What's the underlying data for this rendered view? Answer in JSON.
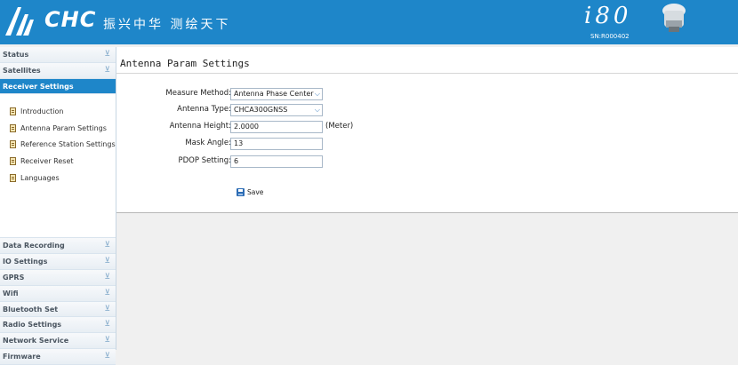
{
  "header": {
    "brand": "CHC",
    "brand_cn": "振兴中华 测绘天下",
    "model": "i80",
    "serial": "SN:R000402"
  },
  "sidebar": {
    "top_items": [
      {
        "label": "Status"
      },
      {
        "label": "Satellites"
      },
      {
        "label": "Receiver Settings"
      }
    ],
    "sub_items": [
      {
        "label": "Introduction"
      },
      {
        "label": "Antenna Param Settings"
      },
      {
        "label": "Reference Station Settings"
      },
      {
        "label": "Receiver Reset"
      },
      {
        "label": "Languages"
      }
    ],
    "bottom_items": [
      {
        "label": "Data Recording"
      },
      {
        "label": "IO Settings"
      },
      {
        "label": "GPRS"
      },
      {
        "label": "Wifi"
      },
      {
        "label": "Bluetooth Set"
      },
      {
        "label": "Radio Settings"
      },
      {
        "label": "Network Service"
      },
      {
        "label": "Firmware"
      }
    ]
  },
  "main": {
    "title": "Antenna Param Settings",
    "measure_method": {
      "label": "Measure Method:",
      "value": "Antenna Phase Center"
    },
    "antenna_type": {
      "label": "Antenna Type:",
      "value": "CHCA300GNSS"
    },
    "antenna_height": {
      "label": "Antenna Height:",
      "value": "2.0000",
      "unit": "(Meter)"
    },
    "mask_angle": {
      "label": "Mask Angle:",
      "value": "13"
    },
    "pdop": {
      "label": "PDOP Setting:",
      "value": "6"
    },
    "save_label": "Save"
  },
  "colors": {
    "accent": "#1e86c9"
  }
}
